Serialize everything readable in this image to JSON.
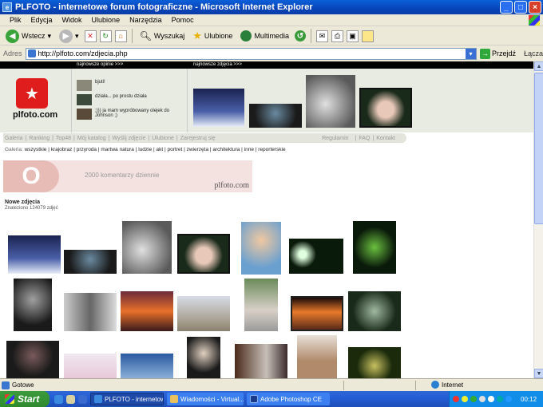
{
  "window": {
    "title": "PLFOTO - internetowe forum fotograficzne - Microsoft Internet Explorer",
    "app_icon": "ie-icon"
  },
  "menu": [
    "Plik",
    "Edycja",
    "Widok",
    "Ulubione",
    "Narzędzia",
    "Pomoc"
  ],
  "toolbar": {
    "back": "Wstecz",
    "search": "Wyszukaj",
    "favorites": "Ulubione",
    "multimedia": "Multimedia"
  },
  "address": {
    "label": "Adres",
    "url": "http://plfoto.com/zdjecia.php",
    "go": "Przejdź",
    "links": "Łącza"
  },
  "page": {
    "top_left": "najnowsze opinie >>>",
    "top_right": "najnowsze zdjęcia >>>",
    "logo_text": "plfoto.com",
    "opinions": [
      "bjuti!",
      "działa... po prostu działa",
      ";))) ja mam wypróbowany olejek do Johnson ;)"
    ],
    "nav": [
      "Galeria",
      "Ranking",
      "Top48",
      "Mój katalog",
      "Wyślij zdjęcie",
      "Ulubione",
      "Zarejestruj się"
    ],
    "nav_right": [
      "Regulamin",
      "FAQ",
      "Kontakt"
    ],
    "gallery_label": "Galeria:",
    "gallery": [
      "wszystkie",
      "krajobraz",
      "przyroda",
      "martwa natura",
      "ludzie",
      "akt",
      "portret",
      "zwierzęta",
      "architektura",
      "inne",
      "reporterskie"
    ],
    "banner_big": "O",
    "banner_text": "2000 komentarzy dziennie",
    "banner_brand": "plfoto.com",
    "new_title": "Nowe zdjęcia",
    "found": "Znaleziono 124079 zdjęć"
  },
  "status": {
    "text": "Gotowe",
    "zone": "Internet"
  },
  "taskbar": {
    "start": "Start",
    "tasks": [
      "PLFOTO - internetow...",
      "Wiadomości - Virtual...",
      "Adobe Photoshop CE"
    ],
    "clock": "00:12"
  },
  "colors": {
    "logo_red": "#e01d1d",
    "xp_blue": "#245dd6",
    "start_green": "#2f8a2f"
  }
}
